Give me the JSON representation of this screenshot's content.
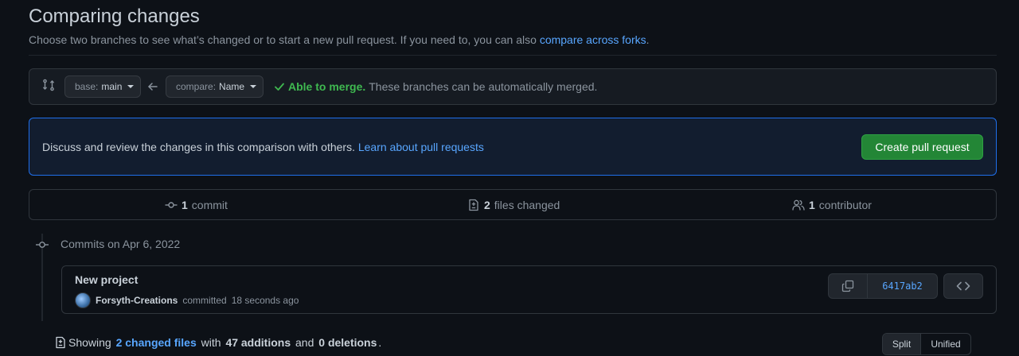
{
  "header": {
    "title": "Comparing changes",
    "subtitle": "Choose two branches to see what’s changed or to start a new pull request. If you need to, you can also ",
    "subtitle_link": "compare across forks",
    "subtitle_end": "."
  },
  "range": {
    "base_prefix": "base:",
    "base_branch": "main",
    "compare_prefix": "compare:",
    "compare_branch": "Name",
    "merge_status": "Able to merge.",
    "merge_detail": "These branches can be automatically merged."
  },
  "pr_box": {
    "text": "Discuss and review the changes in this comparison with others. ",
    "link": "Learn about pull requests",
    "button": "Create pull request"
  },
  "stats": {
    "commits_count": "1",
    "commits_label": "commit",
    "files_count": "2",
    "files_label": "files changed",
    "contributors_count": "1",
    "contributors_label": "contributor"
  },
  "commits": {
    "date_heading": "Commits on Apr 6, 2022",
    "items": [
      {
        "title": "New project",
        "author": "Forsyth-Creations",
        "action": "committed",
        "time": "18 seconds ago",
        "sha": "6417ab2"
      }
    ]
  },
  "diff_summary": {
    "prefix": "Showing ",
    "files_link": "2 changed files",
    "with": " with ",
    "additions": "47 additions",
    "and": " and ",
    "deletions": "0 deletions",
    "end": "."
  },
  "view_toggle": {
    "split": "Split",
    "unified": "Unified"
  },
  "colors": {
    "background": "#0d1117",
    "accent_link": "#58a6ff",
    "success": "#3fb950",
    "primary_button": "#238636",
    "info_border": "#1f6feb"
  }
}
